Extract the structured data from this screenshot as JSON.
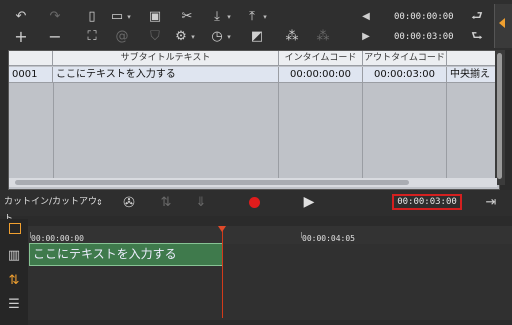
{
  "toolbar": {
    "timecode_in": "00:00:00:00",
    "timecode_out": "00:00:03:00",
    "icons_row1": [
      "undo-icon",
      "redo-icon",
      "new-file-icon",
      "open-folder-icon",
      "save-icon",
      "cut-icon",
      "import-icon",
      "export-icon"
    ],
    "icons_row2": [
      "add-icon",
      "remove-icon",
      "find-icon",
      "search-replace-icon",
      "tag-icon",
      "settings-icon",
      "clock-icon",
      "edit-icon",
      "footprint-in-icon",
      "footprint-out-icon"
    ]
  },
  "grid": {
    "headers": [
      "サブタイトルテキスト",
      "インタイムコード",
      "アウトタイムコード"
    ],
    "rows": [
      {
        "index": "0001",
        "text": "ここにテキストを入力する",
        "in": "00:00:00:00",
        "out": "00:00:03:00",
        "align": "中央揃え"
      }
    ]
  },
  "controls": {
    "mode_select": "カットイン/カットアウト",
    "current_timecode": "00:00:03:00"
  },
  "timeline": {
    "ruler_start": "00:00:00:00",
    "ruler_mid": "00:00:04:05",
    "clip_text": "ここにテキストを入力する"
  },
  "colors": {
    "record": "#e01c1c",
    "clip_fill": "#3f7a4c",
    "playhead": "#d23a1a",
    "accent": "#f0a030"
  }
}
